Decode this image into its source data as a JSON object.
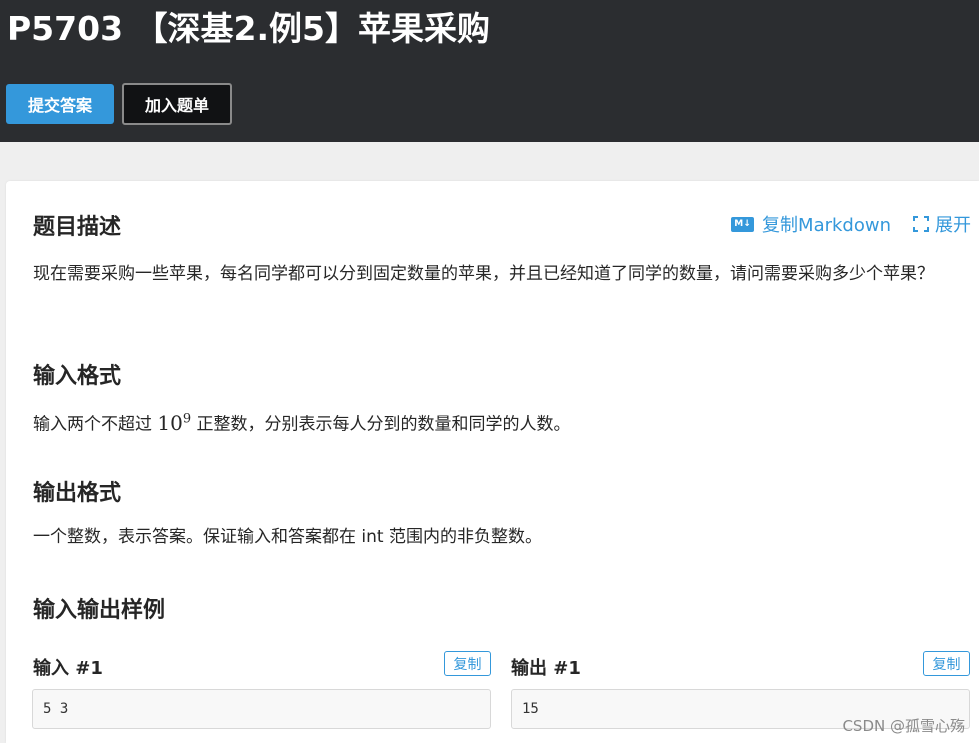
{
  "header": {
    "title": "P5703 【深基2.例5】苹果采购",
    "submit_label": "提交答案",
    "add_label": "加入题单"
  },
  "toolbar": {
    "md_icon_text": "M↓",
    "copy_markdown_label": "复制Markdown",
    "expand_label": "展开"
  },
  "description": {
    "heading": "题目描述",
    "text": "现在需要采购一些苹果，每名同学都可以分到固定数量的苹果，并且已经知道了同学的数量，请问需要采购多少个苹果？"
  },
  "input_format": {
    "heading": "输入格式",
    "text_before": "输入两个不超过 ",
    "math_base": "10",
    "math_exp": "9",
    "text_after": " 正整数，分别表示每人分到的数量和同学的人数。"
  },
  "output_format": {
    "heading": "输出格式",
    "text": "一个整数，表示答案。保证输入和答案都在 int 范围内的非负整数。"
  },
  "samples": {
    "heading": "输入输出样例",
    "input_label": "输入 #1",
    "output_label": "输出 #1",
    "copy_label": "复制",
    "input_value": "5 3",
    "output_value": "15"
  },
  "watermark": "CSDN @孤雪心殇",
  "colors": {
    "header_bg": "#2b2d30",
    "accent": "#3498db",
    "page_bg": "#efefef"
  }
}
